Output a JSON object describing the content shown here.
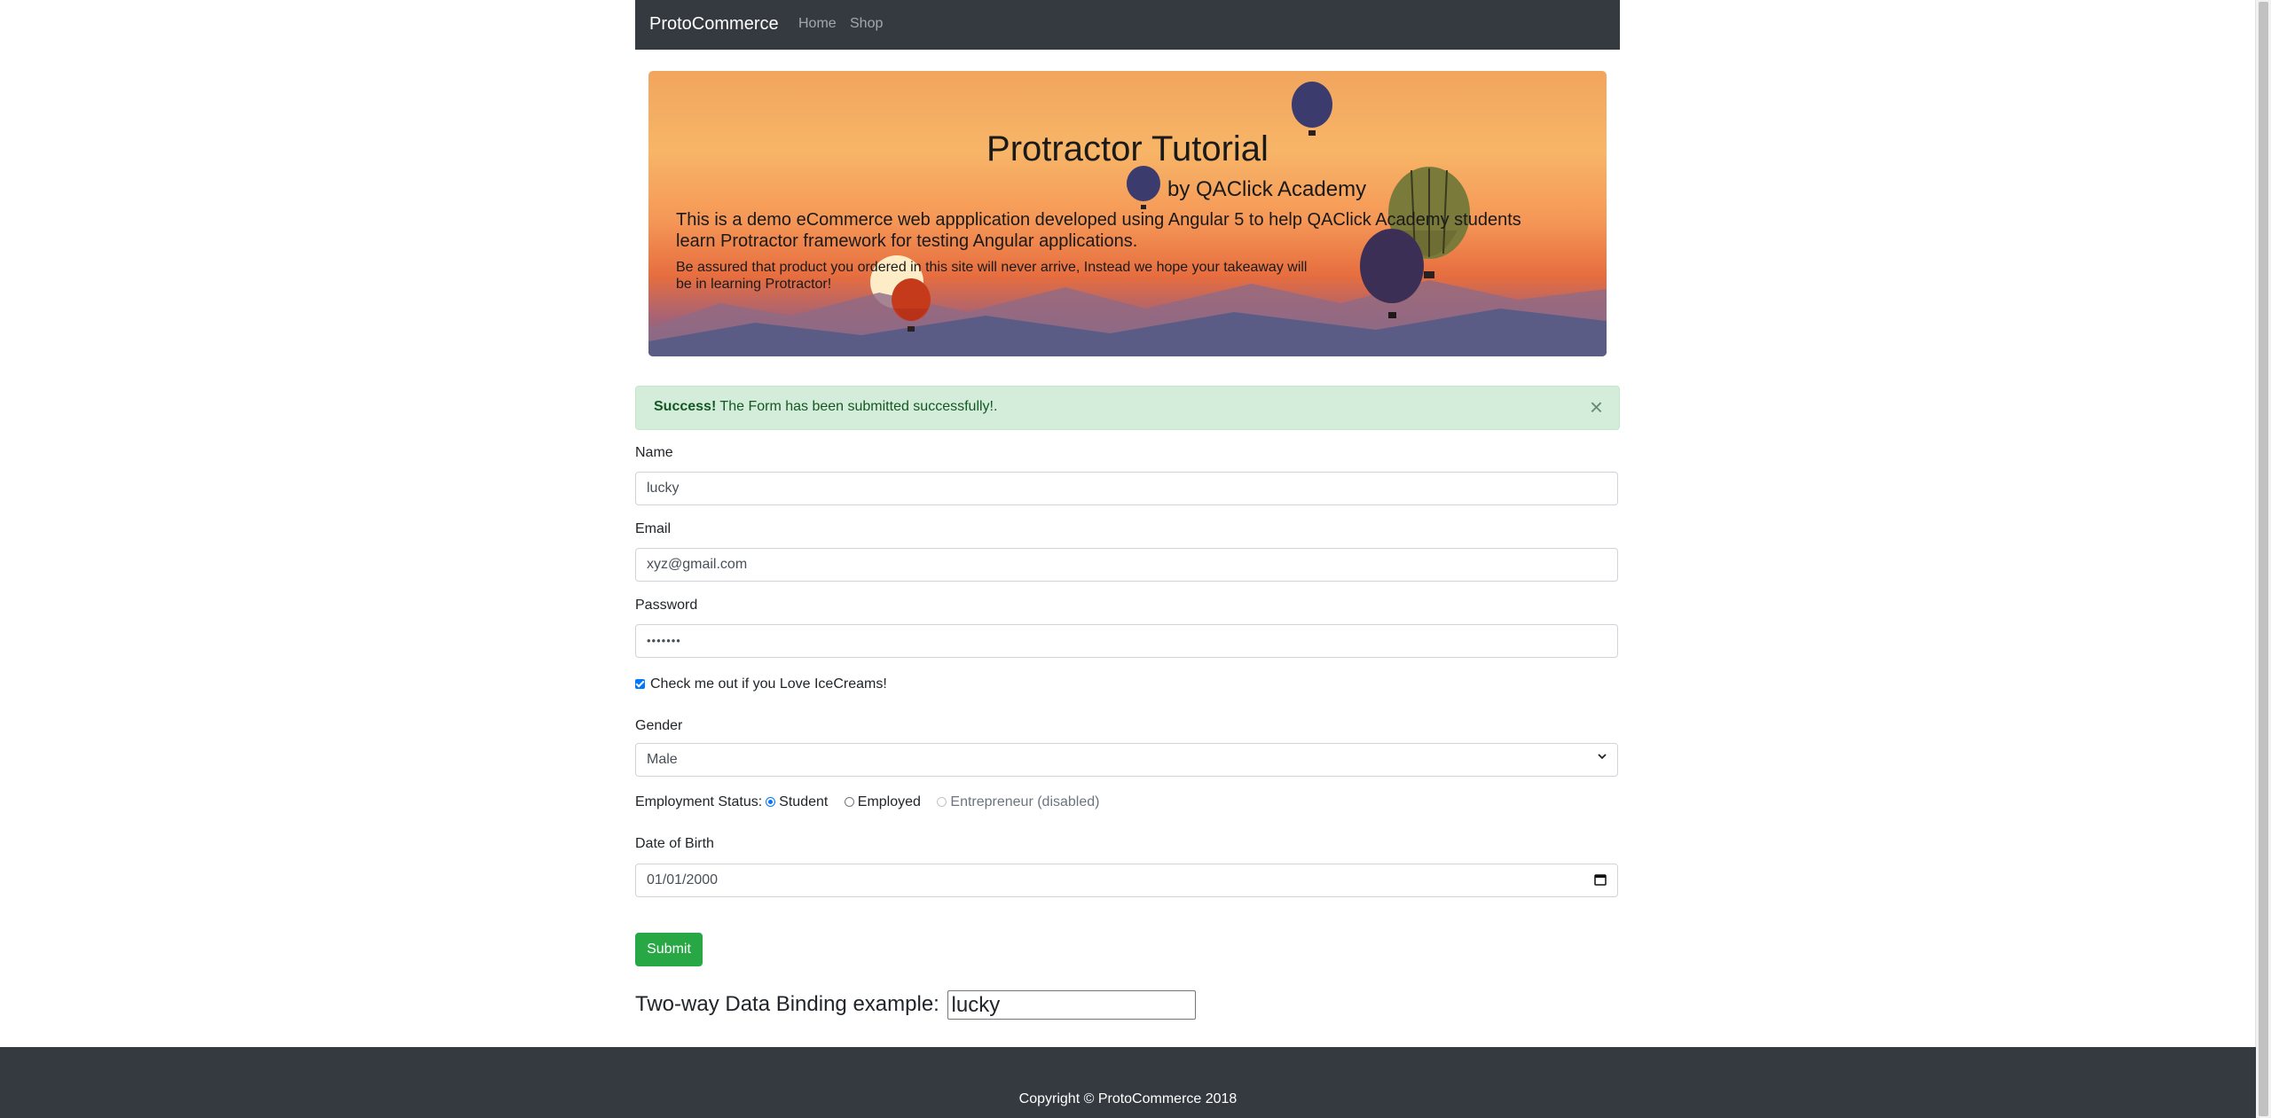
{
  "navbar": {
    "brand": "ProtoCommerce",
    "links": [
      "Home",
      "Shop"
    ]
  },
  "banner": {
    "title": "Protractor Tutorial",
    "subtitle": "by QAClick Academy",
    "description": "This is a demo eCommerce web appplication developed using Angular 5 to help QAClick Academy students learn Protractor framework for testing Angular applications.",
    "note": "Be assured that product you ordered in this site will never arrive, Instead we hope your takeaway will be in learning Protractor!"
  },
  "alert": {
    "strong": "Success!",
    "message": " The Form has been submitted successfully!.",
    "close_glyph": "×"
  },
  "form": {
    "name_label": "Name",
    "name_value": "lucky",
    "email_label": "Email",
    "email_value": "xyz@gmail.com",
    "password_label": "Password",
    "password_value": "•••••••",
    "checkbox_label": "Check me out if you Love IceCreams!",
    "checkbox_checked": true,
    "gender_label": "Gender",
    "gender_value": "Male",
    "employment_label": "Employment Status:",
    "employment_options": [
      {
        "label": "Student",
        "checked": true,
        "disabled": false
      },
      {
        "label": "Employed",
        "checked": false,
        "disabled": false
      },
      {
        "label": "Entrepreneur (disabled)",
        "checked": false,
        "disabled": true
      }
    ],
    "dob_label": "Date of Birth",
    "dob_value": "01/01/2000",
    "submit_label": "Submit"
  },
  "two_way": {
    "label": "Two-way Data Binding example:",
    "value": "lucky"
  },
  "footer": {
    "copyright": "Copyright © ProtoCommerce 2018"
  },
  "colors": {
    "navbar": "#343a40",
    "success_bg": "#d4edda",
    "success_text": "#155724",
    "submit": "#28a745",
    "accent": "#0075ff"
  },
  "icons": [
    "close-icon",
    "chevron-down-icon",
    "calendar-icon"
  ]
}
